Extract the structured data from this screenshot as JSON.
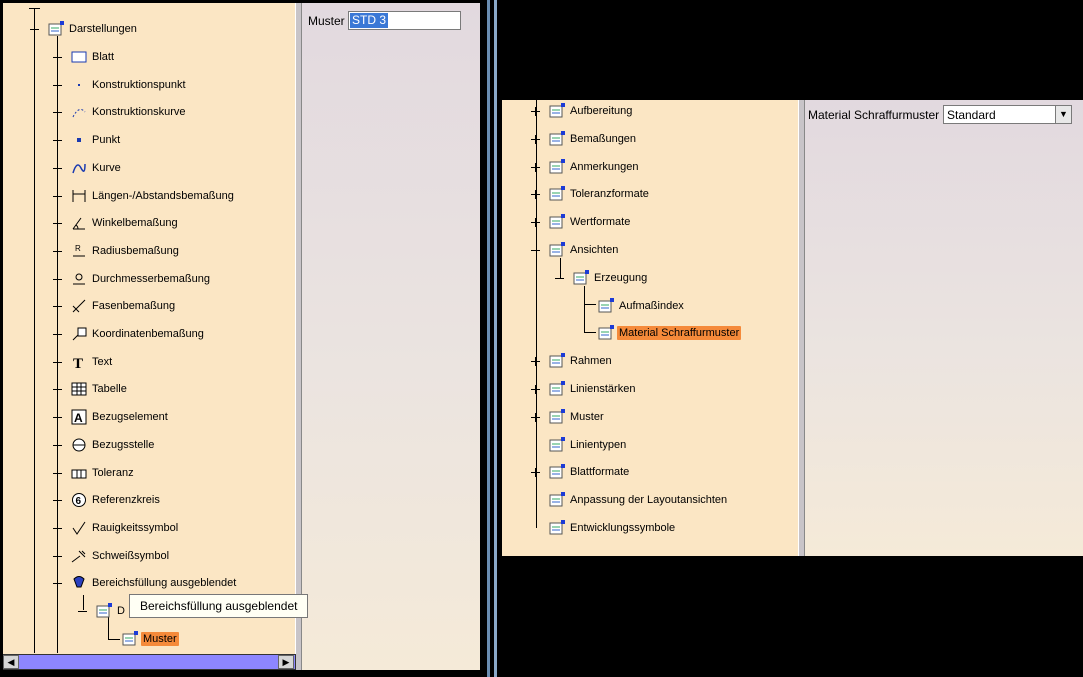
{
  "left_panel": {
    "root_label": "Darstellungen",
    "items": [
      {
        "label": "Blatt",
        "icon": "sheet-icon"
      },
      {
        "label": "Konstruktionspunkt",
        "icon": "construction-point-icon"
      },
      {
        "label": "Konstruktionskurve",
        "icon": "construction-curve-icon"
      },
      {
        "label": "Punkt",
        "icon": "point-icon"
      },
      {
        "label": "Kurve",
        "icon": "curve-icon"
      },
      {
        "label": "Längen-/Abstandsbemaßung",
        "icon": "length-dimension-icon"
      },
      {
        "label": "Winkelbemaßung",
        "icon": "angle-dimension-icon"
      },
      {
        "label": "Radiusbemaßung",
        "icon": "radius-dimension-icon"
      },
      {
        "label": "Durchmesserbemaßung",
        "icon": "diameter-dimension-icon"
      },
      {
        "label": "Fasenbemaßung",
        "icon": "chamfer-dimension-icon"
      },
      {
        "label": "Koordinatenbemaßung",
        "icon": "coordinate-dimension-icon"
      },
      {
        "label": "Text",
        "icon": "text-icon"
      },
      {
        "label": "Tabelle",
        "icon": "table-icon"
      },
      {
        "label": "Bezugselement",
        "icon": "datum-feature-icon"
      },
      {
        "label": "Bezugsstelle",
        "icon": "datum-target-icon"
      },
      {
        "label": "Toleranz",
        "icon": "tolerance-icon"
      },
      {
        "label": "Referenzkreis",
        "icon": "reference-circle-icon"
      },
      {
        "label": "Rauigkeitssymbol",
        "icon": "roughness-symbol-icon"
      },
      {
        "label": "Schweißsymbol",
        "icon": "weld-symbol-icon"
      },
      {
        "label": "Bereichsfüllung ausgeblendet",
        "icon": "area-fill-icon"
      }
    ],
    "child_partial_label": "D",
    "selected_label": "Muster",
    "tooltip": "Bereichsfüllung ausgeblendet"
  },
  "left_props": {
    "field_label": "Muster",
    "field_value": "STD 3"
  },
  "right_panel": {
    "items": [
      {
        "label": "Aufbereitung"
      },
      {
        "label": "Bemaßungen"
      },
      {
        "label": "Anmerkungen"
      },
      {
        "label": "Toleranzformate"
      },
      {
        "label": "Wertformate"
      },
      {
        "label": "Ansichten"
      }
    ],
    "child_label": "Erzeugung",
    "grandchildren": [
      "Aufmaßindex",
      "Material Schraffurmuster"
    ],
    "items_after": [
      {
        "label": "Rahmen"
      },
      {
        "label": "Linienstärken"
      },
      {
        "label": "Muster"
      },
      {
        "label": "Linientypen"
      },
      {
        "label": "Blattformate"
      },
      {
        "label": "Anpassung der Layoutansichten"
      },
      {
        "label": "Entwicklungssymbole"
      }
    ]
  },
  "right_props": {
    "field_label": "Material Schraffurmuster",
    "combo_value": "Standard"
  }
}
